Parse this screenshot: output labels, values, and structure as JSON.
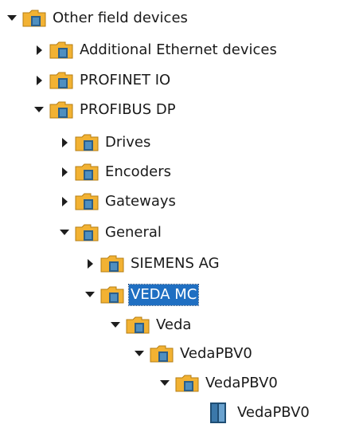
{
  "tree": {
    "items": [
      {
        "label": "Other field devices",
        "expanded": true,
        "icon": "folder-device-icon",
        "depth": 0
      },
      {
        "label": "Additional Ethernet devices",
        "expanded": false,
        "icon": "folder-device-icon",
        "depth": 1
      },
      {
        "label": "PROFINET IO",
        "expanded": false,
        "icon": "folder-device-icon",
        "depth": 1
      },
      {
        "label": "PROFIBUS DP",
        "expanded": true,
        "icon": "folder-device-icon",
        "depth": 1
      },
      {
        "label": "Drives",
        "expanded": false,
        "icon": "folder-device-icon",
        "depth": 2
      },
      {
        "label": "Encoders",
        "expanded": false,
        "icon": "folder-device-icon",
        "depth": 2
      },
      {
        "label": "Gateways",
        "expanded": false,
        "icon": "folder-device-icon",
        "depth": 2
      },
      {
        "label": "General",
        "expanded": true,
        "icon": "folder-device-icon",
        "depth": 2
      },
      {
        "label": "SIEMENS AG",
        "expanded": false,
        "icon": "folder-device-icon",
        "depth": 3
      },
      {
        "label": "VEDA MC",
        "expanded": true,
        "icon": "folder-device-icon",
        "depth": 3,
        "selected": true
      },
      {
        "label": "Veda",
        "expanded": true,
        "icon": "folder-device-icon",
        "depth": 4
      },
      {
        "label": "VedaPBV0",
        "expanded": true,
        "icon": "folder-device-icon",
        "depth": 5
      },
      {
        "label": "VedaPBV0",
        "expanded": true,
        "icon": "folder-device-icon",
        "depth": 6
      },
      {
        "label": "VedaPBV0",
        "leaf": true,
        "icon": "device-module-icon",
        "depth": 7
      }
    ]
  },
  "colors": {
    "selection": "#1f6fc2",
    "folder": "#f2b233",
    "device": "#2c5f8a"
  }
}
